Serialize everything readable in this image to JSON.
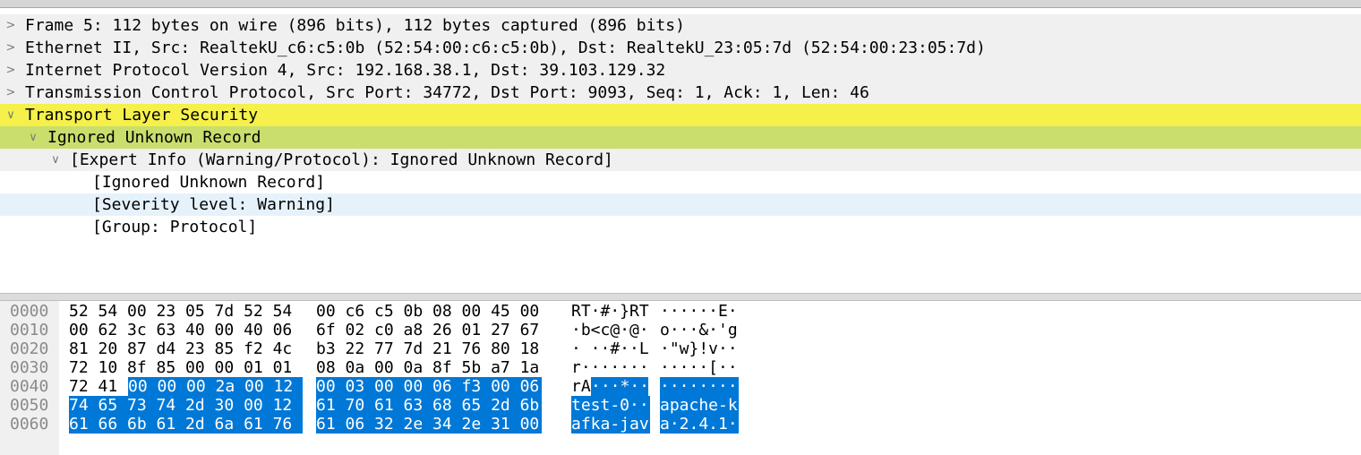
{
  "tree": [
    {
      "text": "Frame 5: 112 bytes on wire (896 bits), 112 bytes captured (896 bits)",
      "arrow": ">"
    },
    {
      "text": "Ethernet II, Src: RealtekU_c6:c5:0b (52:54:00:c6:c5:0b), Dst: RealtekU_23:05:7d (52:54:00:23:05:7d)",
      "arrow": ">"
    },
    {
      "text": "Internet Protocol Version 4, Src: 192.168.38.1, Dst: 39.103.129.32",
      "arrow": ">"
    },
    {
      "text": "Transmission Control Protocol, Src Port: 34772, Dst Port: 9093, Seq: 1, Ack: 1, Len: 46",
      "arrow": ">"
    },
    {
      "text": "Transport Layer Security",
      "arrow": "∨"
    },
    {
      "text": "Ignored Unknown Record",
      "arrow": "∨"
    },
    {
      "text": "[Expert Info (Warning/Protocol): Ignored Unknown Record]",
      "arrow": "∨"
    },
    {
      "text": "[Ignored Unknown Record]",
      "arrow": ""
    },
    {
      "text": "[Severity level: Warning]",
      "arrow": ""
    },
    {
      "text": "[Group: Protocol]",
      "arrow": ""
    }
  ],
  "hex": [
    {
      "offset": "0000",
      "bytes_a": "52 54 00 23 05 7d 52 54",
      "bytes_b": "00 c6 c5 0b 08 00 45 00",
      "ascii_a": "RT·#·}RT",
      "ascii_b": "······E·"
    },
    {
      "offset": "0010",
      "bytes_a": "00 62 3c 63 40 00 40 06",
      "bytes_b": "6f 02 c0 a8 26 01 27 67",
      "ascii_a": "·b<c@·@·",
      "ascii_b": "o···&·'g"
    },
    {
      "offset": "0020",
      "bytes_a": "81 20 87 d4 23 85 f2 4c",
      "bytes_b": "b3 22 77 7d 21 76 80 18",
      "ascii_a": "· ··#··L",
      "ascii_b": "·\"w}!v··"
    },
    {
      "offset": "0030",
      "bytes_a": "72 10 8f 85 00 00 01 01",
      "bytes_b": "08 0a 00 0a 8f 5b a7 1a",
      "ascii_a": "r·······",
      "ascii_b": "·····[··"
    },
    {
      "offset": "0040",
      "bytes_a_plain": "72 41 ",
      "bytes_a_sel": "00 00 00 2a 00 12",
      "bytes_b": "00 03 00 00 06 f3 00 06",
      "ascii_a_plain": "rA",
      "ascii_a_sel": "···*··",
      "ascii_b": "········"
    },
    {
      "offset": "0050",
      "bytes_a": "74 65 73 74 2d 30 00 12",
      "bytes_b": "61 70 61 63 68 65 2d 6b",
      "ascii_a": "test-0··",
      "ascii_b": "apache-k"
    },
    {
      "offset": "0060",
      "bytes_a": "61 66 6b 61 2d 6a 61 76",
      "bytes_b": "61 06 32 2e 34 2e 31 00",
      "ascii_a": "afka-jav",
      "ascii_b": "a·2.4.1·"
    }
  ]
}
